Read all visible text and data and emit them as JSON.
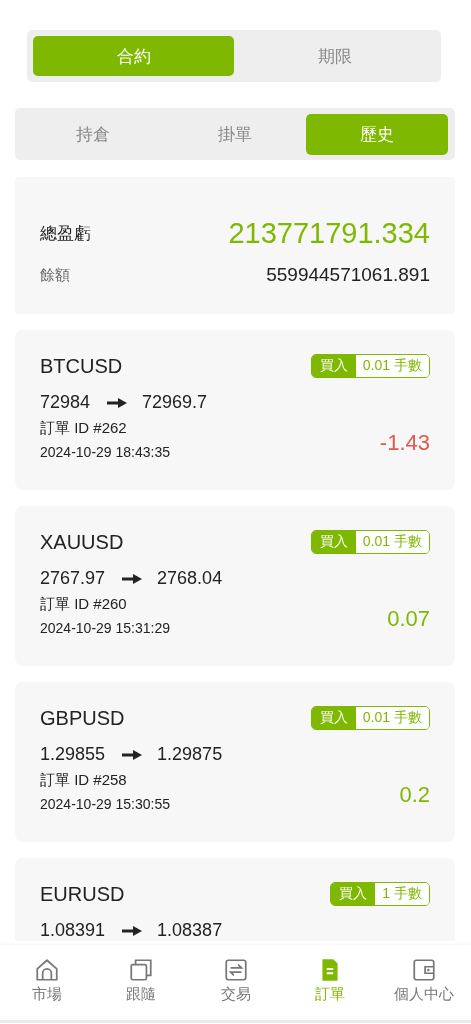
{
  "market_tabs": [
    {
      "label": "合約",
      "selected": true
    },
    {
      "label": "期限",
      "selected": false
    }
  ],
  "order_tabs": [
    {
      "label": "持倉",
      "selected": false
    },
    {
      "label": "掛單",
      "selected": false
    },
    {
      "label": "歷史",
      "selected": true
    }
  ],
  "summary": {
    "total_label": "總盈虧",
    "total_value": "213771791.334",
    "balance_label": "餘額",
    "balance_value": "559944571061.891"
  },
  "orders": [
    {
      "symbol": "BTCUSD",
      "side": "買入",
      "lots": "0.01 手數",
      "open_price": "72984",
      "close_price": "72969.7",
      "order_id": "訂單 ID #262",
      "time": "2024-10-29 18:43:35",
      "profit": "-1.43",
      "kind": "loss"
    },
    {
      "symbol": "XAUUSD",
      "side": "買入",
      "lots": "0.01 手數",
      "open_price": "2767.97",
      "close_price": "2768.04",
      "order_id": "訂單 ID #260",
      "time": "2024-10-29 15:31:29",
      "profit": "0.07",
      "kind": "gain"
    },
    {
      "symbol": "GBPUSD",
      "side": "買入",
      "lots": "0.01 手數",
      "open_price": "1.29855",
      "close_price": "1.29875",
      "order_id": "訂單 ID #258",
      "time": "2024-10-29 15:30:55",
      "profit": "0.2",
      "kind": "gain"
    },
    {
      "symbol": "EURUSD",
      "side": "買入",
      "lots": "1 手數",
      "open_price": "1.08391",
      "close_price": "1.08387"
    }
  ],
  "nav": [
    {
      "label": "市場",
      "selected": false
    },
    {
      "label": "跟隨",
      "selected": false
    },
    {
      "label": "交易",
      "selected": false
    },
    {
      "label": "訂單",
      "selected": true
    },
    {
      "label": "個人中心",
      "selected": false
    }
  ]
}
